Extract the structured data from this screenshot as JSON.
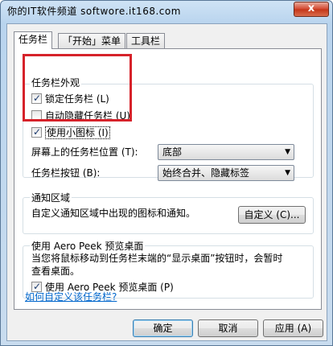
{
  "window": {
    "title": "你的IT软件频道 softwore.it168.com",
    "close_label": "x"
  },
  "tabs": [
    {
      "label": "任务栏"
    },
    {
      "label": "「开始」菜单"
    },
    {
      "label": "工具栏"
    }
  ],
  "appearance": {
    "title": "任务栏外观",
    "lock": {
      "label": "锁定任务栏 (L)",
      "checked": true
    },
    "autohide": {
      "label": "自动隐藏任务栏 (U)",
      "checked": false
    },
    "small_icons": {
      "label": "使用小图标 (I)",
      "checked": true
    },
    "position_label": "屏幕上的任务栏位置 (T):",
    "position_value": "底部",
    "buttons_label": "任务栏按钮 (B):",
    "buttons_value": "始终合并、隐藏标签"
  },
  "notify": {
    "title": "通知区域",
    "description": "自定义通知区域中出现的图标和通知。",
    "customize_button": "自定义 (C)..."
  },
  "aero": {
    "title": "使用 Aero Peek 预览桌面",
    "description_line1": "当您将鼠标移动到任务栏末端的“显示桌面”按钮时，会暂时",
    "description_line2": "查看桌面。",
    "checkbox": {
      "label": "使用 Aero Peek 预览桌面 (P)",
      "checked": true
    }
  },
  "help_link": "如何自定义该任务栏?",
  "footer": {
    "ok": "确定",
    "cancel": "取消",
    "apply": "应用 (A)"
  }
}
